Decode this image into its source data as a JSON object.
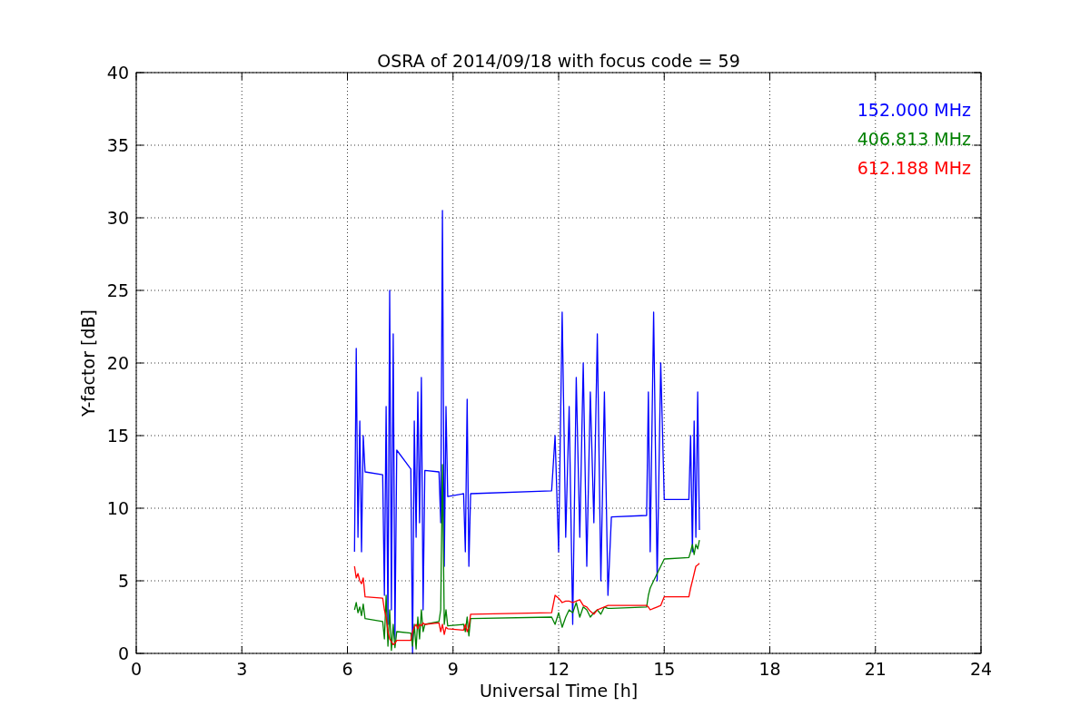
{
  "figure": {
    "chart_data": {
      "type": "line",
      "title": "OSRA of 2014/09/18 with focus code = 59",
      "xlabel": "Universal Time [h]",
      "ylabel": "Y-factor [dB]",
      "x": [
        6.2,
        6.25,
        6.3,
        6.35,
        6.4,
        6.45,
        6.5,
        7.0,
        7.05,
        7.1,
        7.15,
        7.2,
        7.25,
        7.3,
        7.35,
        7.4,
        7.8,
        7.85,
        7.9,
        7.95,
        8.0,
        8.05,
        8.1,
        8.15,
        8.2,
        8.6,
        8.65,
        8.7,
        8.75,
        8.8,
        8.85,
        9.3,
        9.35,
        9.4,
        9.45,
        9.5,
        11.8,
        11.9,
        12.0,
        12.1,
        12.2,
        12.3,
        12.4,
        12.5,
        12.6,
        12.7,
        12.8,
        12.9,
        13.0,
        13.1,
        13.2,
        13.3,
        13.4,
        13.5,
        14.5,
        14.55,
        14.6,
        14.7,
        14.8,
        14.9,
        15.0,
        15.7,
        15.75,
        15.8,
        15.85,
        15.9,
        15.95,
        16.0
      ],
      "series": [
        {
          "name": "152.000 MHz",
          "color": "#0000ff",
          "values": [
            7,
            21,
            8,
            16,
            7,
            15,
            12.5,
            12.3,
            4,
            17,
            2,
            25,
            3,
            22,
            1,
            14,
            12.7,
            0,
            16,
            8,
            18,
            9,
            19,
            3,
            12.6,
            12.5,
            9,
            30.5,
            6,
            17,
            10.8,
            11,
            7,
            17.5,
            6,
            11,
            11.2,
            15,
            7,
            23.5,
            8,
            17,
            2,
            19,
            8,
            20,
            6,
            18,
            9,
            22,
            5,
            18,
            4,
            9.4,
            9.5,
            18,
            7,
            23.5,
            5,
            20,
            10.6,
            10.6,
            15,
            7,
            16,
            8,
            18,
            8.5
          ]
        },
        {
          "name": "406.813 MHz",
          "color": "#008000",
          "values": [
            3,
            3.5,
            2.8,
            3.2,
            2.6,
            3.4,
            2.4,
            2.2,
            1,
            4,
            0.5,
            3,
            0.2,
            2,
            0.4,
            1.5,
            1.4,
            0.5,
            2,
            0.3,
            2.5,
            1,
            3,
            1.5,
            2,
            2.2,
            3,
            13,
            2,
            3,
            1.9,
            2.0,
            1.5,
            2.5,
            1.2,
            2.4,
            2.5,
            2,
            2.8,
            1.8,
            2.5,
            3,
            2.8,
            3.5,
            2.5,
            3.2,
            3.0,
            2.5,
            2.8,
            3,
            2.7,
            3.2,
            3.1,
            3.1,
            3.2,
            4,
            4.5,
            5,
            5.5,
            6,
            6.5,
            6.6,
            7,
            7.5,
            6.8,
            7.5,
            7.2,
            7.8
          ]
        },
        {
          "name": "612.188 MHz",
          "color": "#ff0000",
          "values": [
            6,
            5.2,
            5.5,
            5,
            4.8,
            5.2,
            3.9,
            3.8,
            3,
            2.5,
            1.5,
            1,
            0.8,
            0.6,
            0.7,
            0.9,
            0.9,
            1.5,
            1.8,
            2,
            1.7,
            2,
            1.9,
            2.1,
            2.0,
            2.1,
            1.5,
            2,
            1.3,
            1.8,
            1.7,
            1.6,
            2,
            1.5,
            1.8,
            2.7,
            2.8,
            4,
            3.8,
            3.5,
            3.6,
            3.6,
            3.5,
            3.6,
            3.7,
            3.3,
            3.2,
            2.9,
            2.7,
            3,
            3.1,
            3.2,
            3.3,
            3.3,
            3.3,
            3.2,
            3,
            3.1,
            3.2,
            3.3,
            3.9,
            3.9,
            4.5,
            5,
            5.5,
            6,
            6.1,
            6.2
          ]
        }
      ],
      "grid": true,
      "xlim": [
        0,
        24
      ],
      "ylim": [
        0,
        40
      ],
      "xticks": [
        0,
        3,
        6,
        9,
        12,
        15,
        18,
        21,
        24
      ],
      "yticks": [
        0,
        5,
        10,
        15,
        20,
        25,
        30,
        35,
        40
      ]
    }
  }
}
